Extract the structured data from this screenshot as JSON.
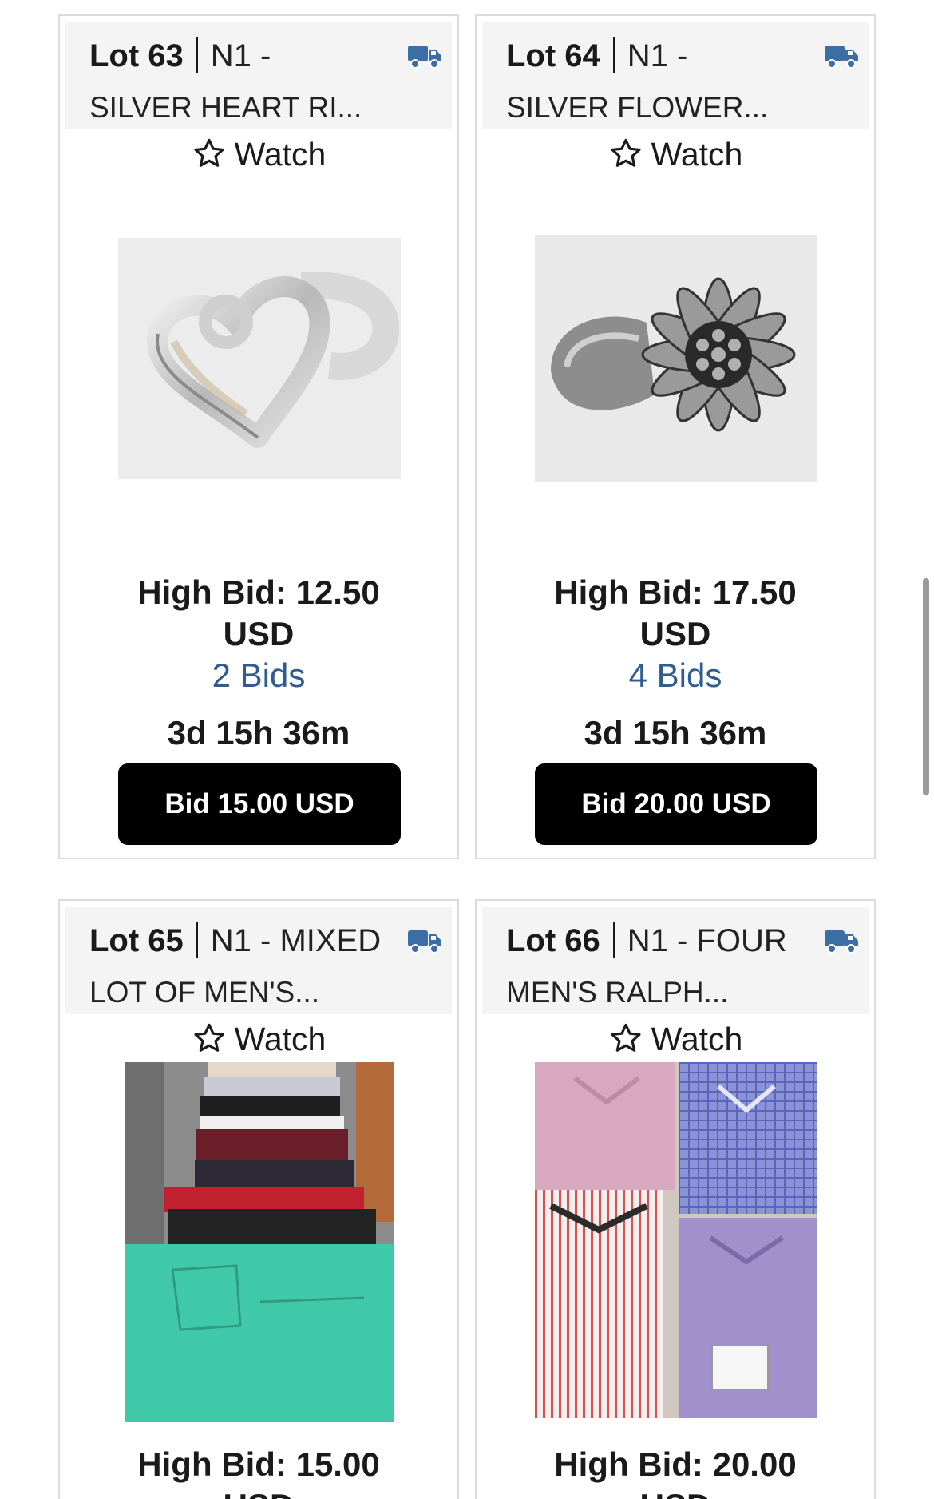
{
  "lots": [
    {
      "lot_label": "Lot 63",
      "title_line1": "N1 -",
      "title_line2": "SILVER HEART RI...",
      "watch_label": "Watch",
      "high_bid_line1": "High Bid: 12.50",
      "high_bid_line2": "USD",
      "bids": "2 Bids",
      "time_left": "3d 15h 36m",
      "bid_button": "Bid 15.00 USD"
    },
    {
      "lot_label": "Lot 64",
      "title_line1": "N1 -",
      "title_line2": "SILVER FLOWER...",
      "watch_label": "Watch",
      "high_bid_line1": "High Bid: 17.50",
      "high_bid_line2": "USD",
      "bids": "4 Bids",
      "time_left": "3d 15h 36m",
      "bid_button": "Bid 20.00 USD"
    },
    {
      "lot_label": "Lot 65",
      "title_line1": "N1 - MIXED",
      "title_line2": "LOT OF MEN'S...",
      "watch_label": "Watch",
      "high_bid_line1": "High Bid: 15.00",
      "high_bid_line2": "USD"
    },
    {
      "lot_label": "Lot 66",
      "title_line1": "N1 - FOUR",
      "title_line2": "MEN'S RALPH...",
      "watch_label": "Watch",
      "high_bid_line1": "High Bid: 20.00",
      "high_bid_line2": "USD"
    }
  ],
  "icons": {
    "shipping": "truck-icon",
    "watch": "star-outline-icon"
  },
  "colors": {
    "link_blue": "#2f5d8f",
    "truck_blue": "#3a6ea5",
    "button_black": "#000000"
  }
}
